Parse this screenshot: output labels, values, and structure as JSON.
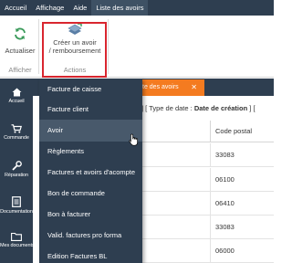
{
  "menubar": {
    "items": [
      "Accueil",
      "Affichage",
      "Aide",
      "Liste des avoirs"
    ]
  },
  "ribbon": {
    "refresh_label": "Actualiser",
    "create_label_line1": "Créer un avoir",
    "create_label_line2": "/ remboursement",
    "group_display": "Afficher",
    "group_actions": "Actions"
  },
  "sidebar": {
    "items": [
      "Accueil",
      "Commande",
      "Réparation",
      "Documentation",
      "Mes documents"
    ]
  },
  "tab": {
    "label": "te des avoirs",
    "close": "✕"
  },
  "filter": {
    "prefix": "] [ Type de date : ",
    "value": "Date de création",
    "suffix": " ] ["
  },
  "grid": {
    "column_header": "Code postal",
    "rows": [
      "33083",
      "06100",
      "06410",
      "33083",
      "06000"
    ]
  },
  "dropdown": {
    "items": [
      "Facture de caisse",
      "Facture client",
      "Avoir",
      "Règlements",
      "Factures et avoirs d'acompte",
      "Bon de commande",
      "Bon à facturer",
      "Valid. factures pro forma",
      "Edition Factures BL"
    ],
    "hovered_index": 2
  },
  "colors": {
    "navy": "#2e3e50",
    "accent_orange": "#f47b20",
    "highlight_red": "#d9262f"
  }
}
